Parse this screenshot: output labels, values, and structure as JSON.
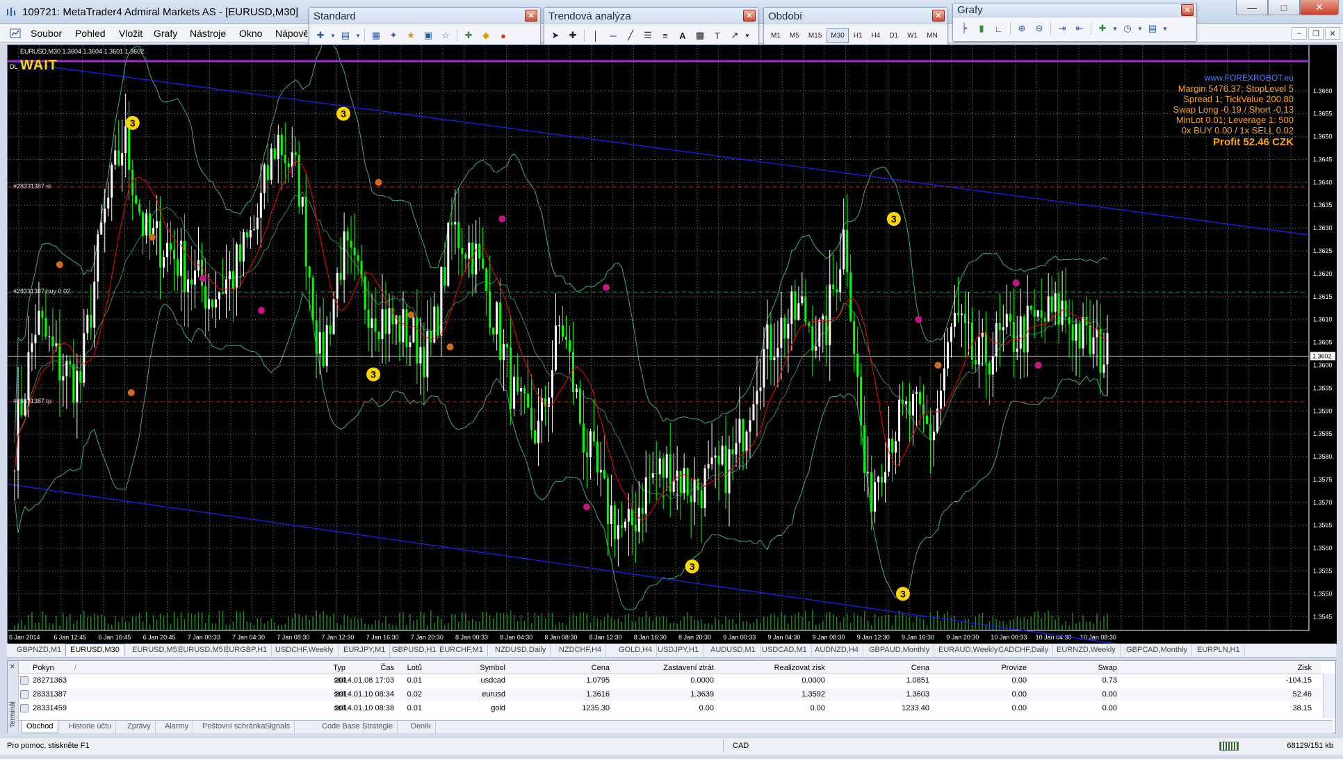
{
  "window": {
    "title": "109721: MetaTrader4 Admiral Markets AS - [EURUSD,M30]"
  },
  "menu": [
    "Soubor",
    "Pohled",
    "Vložit",
    "Grafy",
    "Nástroje",
    "Okno",
    "Nápověda"
  ],
  "toolbars": {
    "standard": {
      "title": "Standard"
    },
    "trend": {
      "title": "Trendová analýza"
    },
    "period": {
      "title": "Období",
      "buttons": [
        "M1",
        "M5",
        "M15",
        "M30",
        "H1",
        "H4",
        "D1",
        "W1",
        "MN"
      ],
      "selected": "M30"
    },
    "charts": {
      "title": "Grafy"
    }
  },
  "chart": {
    "info": "EURUSD,M30  1.3604 1.3604 1.3601 1.3602",
    "dl_label": "DL",
    "wait": "WAIT",
    "current_price": "1.3602",
    "order_labels": [
      "#28331387 sl",
      "#28331387 buy 0.02",
      "#28331387 tp"
    ],
    "panel": {
      "web": "www.FOREXROBOT.eu",
      "lines": [
        "Margin 5476.37; StopLevel 5",
        "Spread 1; TickValue 200.80",
        "Swap Long -0.19 / Short -0.13",
        "MinLot 0.01; Leverage 1: 500",
        "0x BUY 0.00 / 1x SELL 0.02"
      ],
      "profit": "Profit 52.46 CZK"
    },
    "colors": {
      "bg": "#000000",
      "grid": "#808080",
      "bull": "#ffffff",
      "bear": "#00ff00",
      "ma": "#ff0000",
      "bands": "#3cb371",
      "channel": "#1f1fff",
      "resistance": "#9932cc",
      "signal": "#ffd700"
    }
  },
  "chart_data": {
    "type": "candlestick",
    "symbol": "EURUSD",
    "timeframe": "M30",
    "ylim": [
      1.3542,
      1.367
    ],
    "y_ticks": [
      "1.3660",
      "1.3655",
      "1.3650",
      "1.3645",
      "1.3640",
      "1.3635",
      "1.3630",
      "1.3625",
      "1.3620",
      "1.3615",
      "1.3610",
      "1.3605",
      "1.3600",
      "1.3595",
      "1.3590",
      "1.3585",
      "1.3580",
      "1.3575",
      "1.3570",
      "1.3565",
      "1.3560",
      "1.3555",
      "1.3550",
      "1.3545"
    ],
    "x_ticks": [
      "6 Jan 2014",
      "6 Jan 12:45",
      "6 Jan 16:45",
      "6 Jan 20:45",
      "7 Jan 00:33",
      "7 Jan 04:30",
      "7 Jan 08:30",
      "7 Jan 12:30",
      "7 Jan 16:30",
      "7 Jan 20:30",
      "8 Jan 00:33",
      "8 Jan 04:30",
      "8 Jan 08:30",
      "8 Jan 12:30",
      "8 Jan 16:30",
      "8 Jan 20:30",
      "9 Jan 00:33",
      "9 Jan 04:30",
      "9 Jan 08:30",
      "9 Jan 12:30",
      "9 Jan 16:30",
      "9 Jan 20:30",
      "10 Jan 00:33",
      "10 Jan 04:30",
      "10 Jan 08:30"
    ],
    "anchors": [
      1.3583,
      1.361,
      1.36,
      1.3596,
      1.363,
      1.365,
      1.3628,
      1.3626,
      1.362,
      1.3615,
      1.362,
      1.363,
      1.365,
      1.364,
      1.36,
      1.3625,
      1.3615,
      1.361,
      1.3607,
      1.3602,
      1.363,
      1.3625,
      1.361,
      1.359,
      1.3585,
      1.361,
      1.3585,
      1.357,
      1.3562,
      1.3575,
      1.3578,
      1.3573,
      1.3575,
      1.358,
      1.36,
      1.3608,
      1.3612,
      1.3605,
      1.363,
      1.357,
      1.3585,
      1.359,
      1.3585,
      1.361,
      1.36,
      1.3605,
      1.3607,
      1.361,
      1.3612,
      1.3605,
      1.3602
    ],
    "levels": {
      "sl": 1.3639,
      "entry": 1.3616,
      "tp": 1.3592,
      "bid": 1.3602,
      "resistance": 1.36665
    },
    "channel": {
      "top": [
        1.36665,
        1.36285
      ],
      "bottom": [
        1.3574,
        1.3533
      ]
    },
    "signals": [
      {
        "label": "3",
        "x_frac": 0.096,
        "price": 1.3653
      },
      {
        "label": "3",
        "x_frac": 0.258,
        "price": 1.3655
      },
      {
        "label": "3",
        "x_frac": 0.281,
        "price": 1.3598
      },
      {
        "label": "3",
        "x_frac": 0.526,
        "price": 1.3556
      },
      {
        "label": "3",
        "x_frac": 0.681,
        "price": 1.3632
      },
      {
        "label": "3",
        "x_frac": 0.688,
        "price": 1.355
      }
    ]
  },
  "symbol_tabs": [
    "GBPNZD,M1",
    "EURUSD,M30",
    "EURUSD,M5",
    "EURUSD,M5",
    "EURGBP,H1",
    "USDCHF,Weekly",
    "EURJPY,M1",
    "GBPUSD,H1",
    "EURCHF,M1",
    "NZDUSD,Daily",
    "NZDCHF,H4",
    "GOLD,H4",
    "USDJPY,H1",
    "AUDUSD,M1",
    "USDCAD,M1",
    "AUDNZD,H4",
    "GBPAUD,Monthly",
    "EURAUD,Weekly",
    "CADCHF,Daily",
    "EURNZD,Weekly",
    "GBPCAD,Monthly",
    "EURPLN,H1"
  ],
  "active_symbol_tab": "EURUSD,M30",
  "terminal": {
    "side_label": "Terminál",
    "columns": [
      "Pokyn",
      "Čas",
      "Typ",
      "Lotů",
      "Symbol",
      "Cena",
      "Zastavení ztrát",
      "Realizovat zisk",
      "Cena",
      "Provize",
      "Swap",
      "Zisk"
    ],
    "sort_mark": "/",
    "rows": [
      [
        "28271363",
        "2014.01.08 17:03",
        "sell",
        "0.01",
        "usdcad",
        "1.0795",
        "0.0000",
        "0.0000",
        "1.0851",
        "0.00",
        "0.73",
        "-104.15"
      ],
      [
        "28331387",
        "2014.01.10 08:34",
        "sell",
        "0.02",
        "eurusd",
        "1.3616",
        "1.3639",
        "1.3592",
        "1.3603",
        "0.00",
        "0.00",
        "52.46"
      ],
      [
        "28331459",
        "2014.01.10 08:38",
        "sell",
        "0.01",
        "gold",
        "1235.30",
        "0.00",
        "0.00",
        "1233.40",
        "0.00",
        "0.00",
        "38.15"
      ]
    ],
    "tabs": [
      "Obchod",
      "Historie účtu",
      "Zprávy",
      "Alarmy",
      "Poštovní schránka",
      "Signals",
      "Code Base",
      "Strategie",
      "Deník"
    ],
    "active_tab": "Obchod"
  },
  "status": {
    "help": "Pro pomoc, stiskněte F1",
    "profile": "CAD",
    "traffic": "68129/151 kb"
  }
}
